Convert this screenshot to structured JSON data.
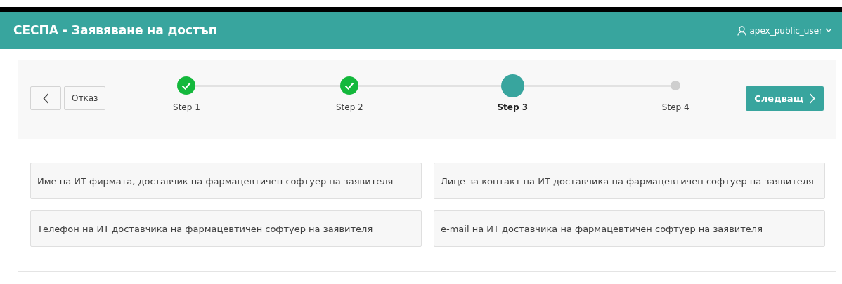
{
  "header": {
    "title": "СЕСПА - Заявяване на достъп",
    "user": "apex_public_user"
  },
  "wizard": {
    "cancel": "Отказ",
    "next": "Следващ",
    "steps": [
      {
        "label": "Step 1",
        "completed": true,
        "selected": false
      },
      {
        "label": "Step 2",
        "completed": true,
        "selected": false
      },
      {
        "label": "Step 3",
        "completed": false,
        "selected": true
      },
      {
        "label": "Step 4",
        "completed": false,
        "selected": false
      }
    ]
  },
  "fields": [
    {
      "placeholder": "Име на ИТ фирмата, доставчик на фармацевтичен софтуер на заявителя"
    },
    {
      "placeholder": "Лице за контакт на ИТ доставчика на фармацевтичен софтуер на заявителя"
    },
    {
      "placeholder": "Телефон на ИТ доставчика на фармацевтичен софтуер на заявителя"
    },
    {
      "placeholder": "e-mail на ИТ доставчика на фармацевтичен софтуер на заявителя"
    }
  ]
}
